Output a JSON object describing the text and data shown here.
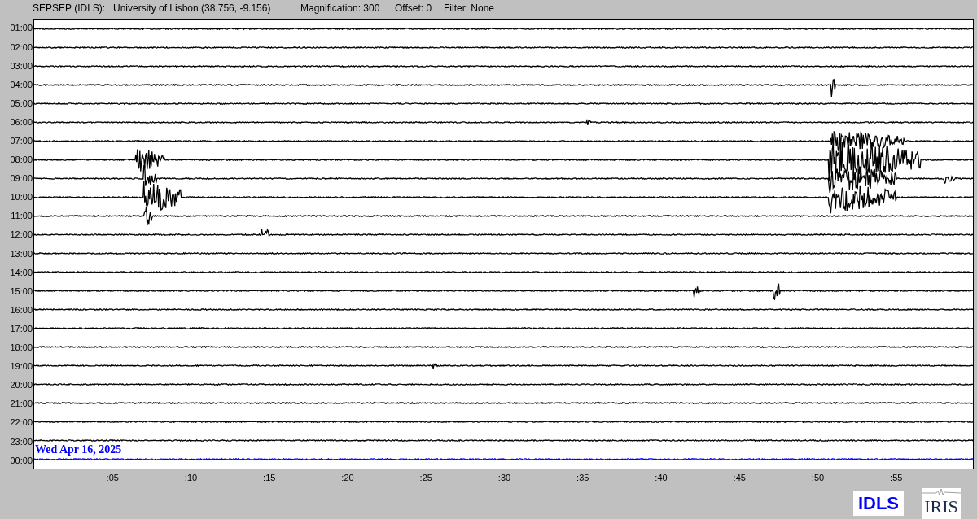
{
  "header": {
    "station": "SEPSEP (IDLS):",
    "location": "University of Lisbon (38.756, -9.156)",
    "magnification": "Magnification: 300",
    "offset": "Offset: 0",
    "filter": "Filter: None"
  },
  "rows": [
    {
      "label": "01:00",
      "current": false
    },
    {
      "label": "02:00",
      "current": false
    },
    {
      "label": "03:00",
      "current": false
    },
    {
      "label": "04:00",
      "current": false
    },
    {
      "label": "05:00",
      "current": false
    },
    {
      "label": "06:00",
      "current": false
    },
    {
      "label": "07:00",
      "current": false
    },
    {
      "label": "08:00",
      "current": false
    },
    {
      "label": "09:00",
      "current": false
    },
    {
      "label": "10:00",
      "current": false
    },
    {
      "label": "11:00",
      "current": false
    },
    {
      "label": "12:00",
      "current": false
    },
    {
      "label": "13:00",
      "current": false
    },
    {
      "label": "14:00",
      "current": false
    },
    {
      "label": "15:00",
      "current": false
    },
    {
      "label": "16:00",
      "current": false
    },
    {
      "label": "17:00",
      "current": false
    },
    {
      "label": "18:00",
      "current": false
    },
    {
      "label": "19:00",
      "current": false
    },
    {
      "label": "20:00",
      "current": false
    },
    {
      "label": "21:00",
      "current": false
    },
    {
      "label": "22:00",
      "current": false
    },
    {
      "label": "23:00",
      "current": false
    },
    {
      "label": "00:00",
      "current": true
    }
  ],
  "date": "Wed Apr 16, 2025",
  "x_ticks": [
    ":05",
    ":10",
    ":15",
    ":20",
    ":25",
    ":30",
    ":35",
    ":40",
    ":45",
    ":50",
    ":55"
  ],
  "logos": {
    "network": "IDLS",
    "institution": "IRIS"
  }
}
